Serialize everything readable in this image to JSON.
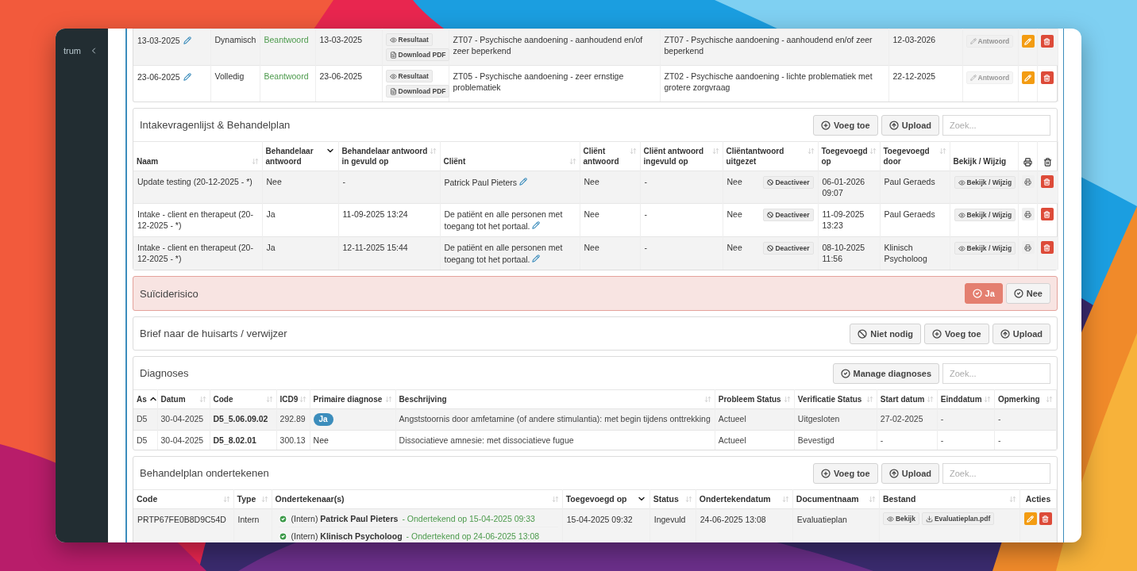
{
  "sidebar": {
    "label": "trum"
  },
  "top_table": {
    "rows": [
      {
        "column_1": "13-03-2025",
        "column_2": "Dynamisch",
        "column_3": "Beantwoord",
        "column_4": "13-03-2025",
        "buttons": [
          {
            "label": "Resultaat",
            "kind": "view"
          },
          {
            "label": "Download PDF",
            "kind": "file"
          }
        ],
        "column_6": "ZT07 - Psychische aandoening - aanhoudend en/of zeer beperkend",
        "column_7": "ZT07 - Psychische aandoening - aanhoudend en/of zeer beperkend",
        "column_8": "12-03-2026",
        "answer_button": "Antwoord",
        "answer_disabled": true
      },
      {
        "column_1": "23-06-2025",
        "column_2": "Volledig",
        "column_3": "Beantwoord",
        "column_4": "23-06-2025",
        "buttons": [
          {
            "label": "Resultaat",
            "kind": "view"
          },
          {
            "label": "Download PDF",
            "kind": "file"
          }
        ],
        "column_6": "ZT05 - Psychische aandoening - zeer ernstige problematiek",
        "column_7": "ZT02 - Psychische aandoening - lichte problematiek met grotere zorgvraag",
        "column_8": "22-12-2025",
        "answer_button": "Antwoord",
        "answer_disabled": true
      }
    ]
  },
  "intake": {
    "title": "Intakevragenlijst & Behandelplan",
    "buttons": [
      {
        "label": "Voeg toe",
        "kind": "add"
      },
      {
        "label": "Upload",
        "kind": "upload"
      }
    ],
    "search": {
      "placeholder": "Zoek..."
    },
    "columns": [
      {
        "label": "Naam",
        "sortable": true
      },
      {
        "label": "Behandelaar antwoord",
        "sortable": true,
        "sorted": true,
        "ascending": false
      },
      {
        "label": "Behandelaar antwoord in gevuld op",
        "sortable": true
      },
      {
        "label": "Cliënt",
        "sortable": true
      },
      {
        "label": "Cliënt antwoord",
        "sortable": true
      },
      {
        "label": "Cliënt antwoord ingevuld op",
        "sortable": true
      },
      {
        "label": "Cliëntantwoord uitgezet",
        "sortable": true
      },
      {
        "label": "Toegevoegd op",
        "sortable": true
      },
      {
        "label": "Toegevoegd door",
        "sortable": true
      },
      {
        "label": "Bekijk / Wijzig",
        "sortable": false
      }
    ],
    "rows": [
      {
        "cells": [
          "Update testing (20-12-2025 - *)",
          "Nee",
          "-",
          "Patrick Paul Pieters",
          "Nee",
          "-",
          "Nee",
          "06-01-2026 09:07",
          "Paul Geraeds"
        ],
        "deactivate_button": "Deactiveer",
        "view_button": "Bekijk / Wijzig"
      },
      {
        "cells": [
          "Intake - client en therapeut (20-12-2025 - *)",
          "Ja",
          "11-09-2025 13:24",
          "De patiënt en alle personen met toegang tot het portaal.",
          "Nee",
          "-",
          "Nee",
          "11-09-2025 13:23",
          "Paul Geraeds"
        ],
        "deactivate_button": "Deactiveer",
        "view_button": "Bekijk / Wijzig"
      },
      {
        "cells": [
          "Intake - client en therapeut (20-12-2025 - *)",
          "Ja",
          "12-11-2025 15:44",
          "De patiënt en alle personen met toegang tot het portaal.",
          "Nee",
          "-",
          "Nee",
          "08-10-2025 11:56",
          "Klinisch Psycholoog"
        ],
        "deactivate_button": "Deactiveer",
        "view_button": "Bekijk / Wijzig"
      }
    ]
  },
  "suicide_risk": {
    "title": "Suïciderisico",
    "options": [
      {
        "label": "Ja",
        "selected": true
      },
      {
        "label": "Nee",
        "selected": false
      }
    ]
  },
  "referral_letter": {
    "title": "Brief naar de huisarts / verwijzer",
    "buttons": [
      {
        "label": "Niet nodig",
        "kind": "not_needed"
      },
      {
        "label": "Voeg toe",
        "kind": "add"
      },
      {
        "label": "Upload",
        "kind": "upload"
      }
    ]
  },
  "diagnoses": {
    "title": "Diagnoses",
    "buttons": [
      {
        "label": "Manage diagnoses",
        "kind": "manage"
      }
    ],
    "search": {
      "placeholder": "Zoek..."
    },
    "columns": [
      {
        "label": "As",
        "sortable": true,
        "sorted": true,
        "ascending": true
      },
      {
        "label": "Datum",
        "sortable": true
      },
      {
        "label": "Code",
        "sortable": true
      },
      {
        "label": "ICD9",
        "sortable": true
      },
      {
        "label": "Primaire diagnose",
        "sortable": true
      },
      {
        "label": "Beschrijving",
        "sortable": true
      },
      {
        "label": "Probleem Status",
        "sortable": true
      },
      {
        "label": "Verificatie Status",
        "sortable": true
      },
      {
        "label": "Start datum",
        "sortable": true
      },
      {
        "label": "Einddatum",
        "sortable": true
      },
      {
        "label": "Opmerking",
        "sortable": true
      }
    ],
    "rows": [
      {
        "as": "D5",
        "date": "30-04-2025",
        "code": "D5_5.06.09.02",
        "icd9": "292.89",
        "primary": "Ja",
        "primary_badge": true,
        "description": "Angststoornis door amfetamine (of andere stimulantia): met begin tijdens onttrekking",
        "problem_status": "Actueel",
        "verification_status": "Uitgesloten",
        "start_date": "27-02-2025",
        "end_date": "-",
        "remark": "-"
      },
      {
        "as": "D5",
        "date": "30-04-2025",
        "code": "D5_8.02.01",
        "icd9": "300.13",
        "primary": "Nee",
        "primary_badge": false,
        "description": "Dissociatieve amnesie: met dissociatieve fugue",
        "problem_status": "Actueel",
        "verification_status": "Bevestigd",
        "start_date": "-",
        "end_date": "-",
        "remark": "-"
      }
    ]
  },
  "signing": {
    "title": "Behandelplan ondertekenen",
    "buttons": [
      {
        "label": "Voeg toe",
        "kind": "add"
      },
      {
        "label": "Upload",
        "kind": "upload"
      }
    ],
    "search": {
      "placeholder": "Zoek..."
    },
    "columns": [
      {
        "label": "Code",
        "sortable": true
      },
      {
        "label": "Type",
        "sortable": true
      },
      {
        "label": "Ondertekenaar(s)",
        "sortable": true
      },
      {
        "label": "Toegevoegd op",
        "sortable": true,
        "sorted": true,
        "ascending": false
      },
      {
        "label": "Status",
        "sortable": true
      },
      {
        "label": "Ondertekendatum",
        "sortable": true
      },
      {
        "label": "Documentnaam",
        "sortable": true
      },
      {
        "label": "Bestand",
        "sortable": true
      },
      {
        "label": "Acties",
        "sortable": false
      }
    ],
    "rows": [
      {
        "code": "PRTP67FE0B8D9C54D",
        "type": "Intern",
        "signers": [
          {
            "signer": "(Intern) **Patrick Paul Pieters**",
            "note": "- Ondertekend op 15-04-2025 09:33",
            "signed": true
          },
          {
            "signer": "(Intern) **Klinisch Psycholoog**",
            "note": "- Ondertekend op 24-06-2025 13:08",
            "signed": true
          }
        ],
        "added": "15-04-2025 09:32",
        "status": "Ingevuld",
        "signed_date": "24-06-2025 13:08",
        "document": "Evaluatieplan",
        "view_button": "Bekijk",
        "download_button": "Evaluatieplan.pdf"
      }
    ]
  }
}
